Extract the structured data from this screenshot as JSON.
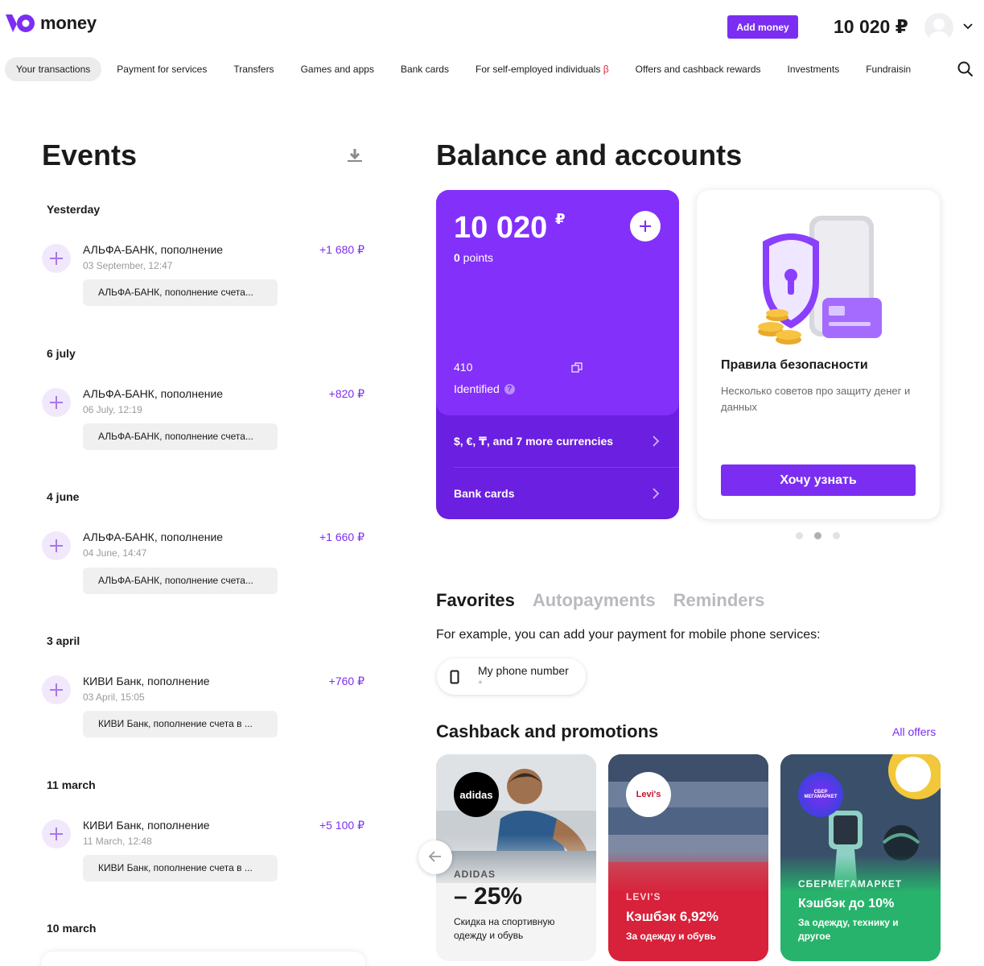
{
  "header": {
    "logo_text": "money",
    "add_money_label": "Add money",
    "balance": "10 020 ₽"
  },
  "nav": {
    "items": [
      {
        "label": "Your transactions",
        "active": true
      },
      {
        "label": "Payment for services"
      },
      {
        "label": "Transfers"
      },
      {
        "label": "Games and apps"
      },
      {
        "label": "Bank cards"
      },
      {
        "label": "For self-employed individuals",
        "badge": "β"
      },
      {
        "label": "Offers and cashback rewards"
      },
      {
        "label": "Investments"
      },
      {
        "label": "Fundraisin"
      }
    ]
  },
  "events": {
    "title": "Events",
    "groups": [
      {
        "date": "Yesterday",
        "title": "АЛЬФА-БАНК, пополнение",
        "time": "03 September, 12:47",
        "amount": "+1 680 ₽",
        "chip": "АЛЬФА-БАНК, пополнение счета..."
      },
      {
        "date": "6 july",
        "title": "АЛЬФА-БАНК, пополнение",
        "time": "06 July, 12:19",
        "amount": "+820 ₽",
        "chip": "АЛЬФА-БАНК, пополнение счета..."
      },
      {
        "date": "4 june",
        "title": "АЛЬФА-БАНК, пополнение",
        "time": "04 June, 14:47",
        "amount": "+1 660 ₽",
        "chip": "АЛЬФА-БАНК, пополнение счета..."
      },
      {
        "date": "3 april",
        "title": "КИВИ Банк, пополнение",
        "time": "03 April, 15:05",
        "amount": "+760 ₽",
        "chip": "КИВИ Банк, пополнение счета в ..."
      },
      {
        "date": "11 march",
        "title": "КИВИ Банк, пополнение",
        "time": "11 March, 12:48",
        "amount": "+5 100 ₽",
        "chip": "КИВИ Банк, пополнение счета в ..."
      },
      {
        "date": "10 march"
      }
    ]
  },
  "balance": {
    "title": "Balance and accounts",
    "amount": "10 020",
    "currency": "₽",
    "points_value": "0",
    "points_label": " points",
    "account_number": "410",
    "status": "Identified",
    "currencies_link": "$, €, ₸, and 7 more currencies",
    "cards_link": "Bank cards"
  },
  "promo": {
    "title": "Правила безопасности",
    "description": "Несколько советов про защиту денег и данных",
    "button": "Хочу узнать"
  },
  "tabs": [
    "Favorites",
    "Autopayments",
    "Reminders"
  ],
  "favorites": {
    "hint": "For example, you can add your payment for mobile phone services:",
    "phone_label": "My phone number",
    "phone_sub": "+"
  },
  "cashback": {
    "title": "Cashback and promotions",
    "all_link": "All offers",
    "offers": [
      {
        "logo": "adidas",
        "brand": "ADIDAS",
        "headline": "– 25%",
        "description": "Скидка на спортивную одежду и обувь"
      },
      {
        "logo": "Levi's",
        "brand": "LEVI'S",
        "headline": "Кэшбэк 6,92%",
        "description": "За одежду и обувь"
      },
      {
        "logo": "СБЕР МЕГАМАРКЕТ",
        "brand": "СБЕРМЕГАМАРКЕТ",
        "headline": "Кэшбэк до 10%",
        "description": "За одежду, технику и другое"
      }
    ]
  },
  "colors": {
    "accent": "#7b2ef2",
    "card_bg": "#8330fb",
    "card_bottom": "#6b1fe0",
    "levis_red": "#d8213a",
    "sber_green": "#27b36b"
  }
}
